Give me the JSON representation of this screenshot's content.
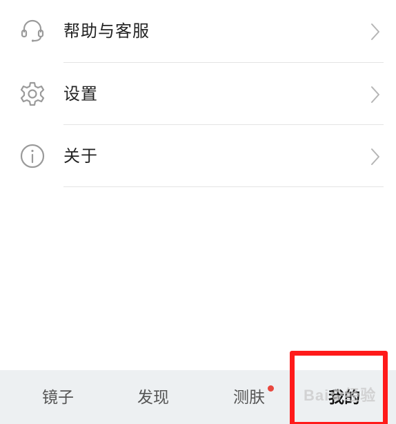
{
  "menu": {
    "items": [
      {
        "label": "帮助与客服",
        "icon": "headset-icon"
      },
      {
        "label": "设置",
        "icon": "gear-icon"
      },
      {
        "label": "关于",
        "icon": "info-icon"
      }
    ]
  },
  "tabbar": {
    "tabs": [
      {
        "label": "镜子",
        "active": false
      },
      {
        "label": "发现",
        "active": false
      },
      {
        "label": "测肤",
        "active": false,
        "badge": true
      },
      {
        "label": "我的",
        "active": true
      }
    ]
  },
  "watermark": {
    "text": "Bai",
    "suffix": "经验"
  },
  "colors": {
    "text": "#222222",
    "tab_text": "#555555",
    "tab_active": "#111111",
    "tabbar_bg": "#edf0f2",
    "divider": "#e3e3e3",
    "badge": "#e8473e",
    "highlight": "#ff1a1a",
    "icon": "#9a9a9a"
  }
}
